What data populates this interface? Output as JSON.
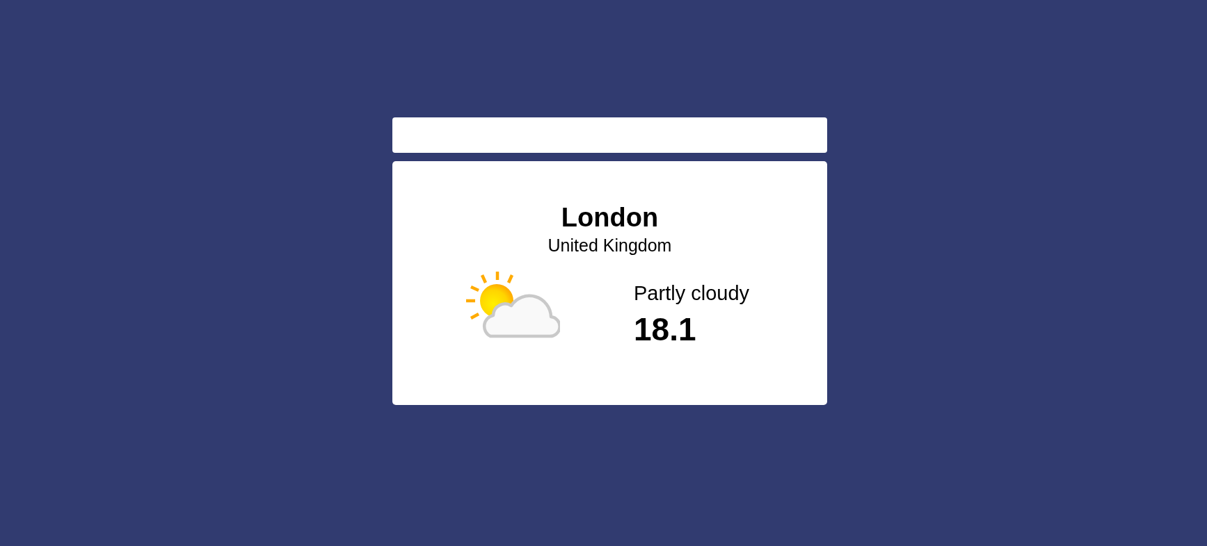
{
  "location": {
    "city": "London",
    "country": "United Kingdom"
  },
  "current": {
    "icon": {
      "kind": "partly_cloudy"
    },
    "condition": "Partly cloudy",
    "temperature": "18.1"
  }
}
